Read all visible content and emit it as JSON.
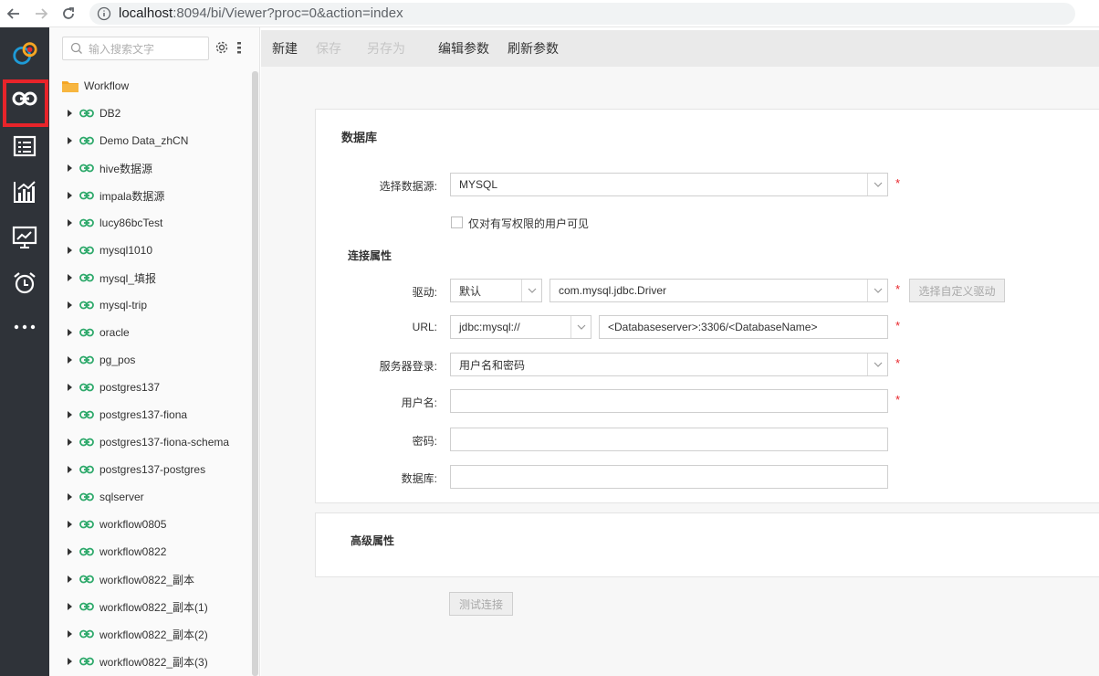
{
  "browser": {
    "url_host": "localhost",
    "url_rest": ":8094/bi/Viewer?proc=0&action=index"
  },
  "rail": {
    "items": [
      "logo-icon",
      "data-source-icon",
      "report-icon",
      "chart-icon",
      "dashboard-icon",
      "schedule-icon",
      "more-icon"
    ]
  },
  "tree": {
    "search_placeholder": "输入搜索文字",
    "root_label": "Workflow",
    "items": [
      "DB2",
      "Demo Data_zhCN",
      "hive数据源",
      "impala数据源",
      "lucy86bcTest",
      "mysql1010",
      "mysql_填报",
      "mysql-trip",
      "oracle",
      "pg_pos",
      "postgres137",
      "postgres137-fiona",
      "postgres137-fiona-schema",
      "postgres137-postgres",
      "sqlserver",
      "workflow0805",
      "workflow0822",
      "workflow0822_副本",
      "workflow0822_副本(1)",
      "workflow0822_副本(2)",
      "workflow0822_副本(3)"
    ]
  },
  "toolbar": {
    "new": "新建",
    "save": "保存",
    "save_as": "另存为",
    "edit_params": "编辑参数",
    "refresh_params": "刷新参数"
  },
  "form": {
    "db_section": "数据库",
    "datasource_label": "选择数据源:",
    "datasource_value": "MYSQL",
    "writable_only": "仅对有写权限的用户可见",
    "conn_section": "连接属性",
    "driver_label": "驱动:",
    "driver_mode": "默认",
    "driver_value": "com.mysql.jdbc.Driver",
    "custom_driver_button": "选择自定义驱动",
    "url_label": "URL:",
    "url_prefix": "jdbc:mysql://",
    "url_value": "<Databaseserver>:3306/<DatabaseName>",
    "login_label": "服务器登录:",
    "login_value": "用户名和密码",
    "username_label": "用户名:",
    "username_value": "",
    "password_label": "密码:",
    "password_value": "",
    "database_label": "数据库:",
    "database_value": "",
    "required_mark": "*",
    "adv_section": "高级属性",
    "test_button": "测试连接"
  },
  "colors": {
    "rail_bg": "#2f3339",
    "active_outline": "#e8242a",
    "link_green": "#2ea96b",
    "folder_orange": "#f5a623"
  }
}
